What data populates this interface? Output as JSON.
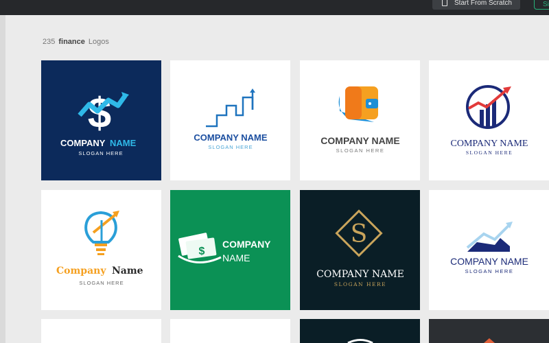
{
  "topbar": {
    "start_from_scratch": "Start From Scratch",
    "second_button": "Si"
  },
  "heading": {
    "count": "235",
    "term": "finance",
    "suffix": "Logos"
  },
  "logos": [
    {
      "name": "COMPANY",
      "name2": "NAME",
      "slogan": "SLOGAN HERE",
      "bg": "#0c2a5b"
    },
    {
      "name": "COMPANY NAME",
      "slogan": "SLOGAN HERE",
      "bg": "#ffffff"
    },
    {
      "name": "COMPANY NAME",
      "slogan": "SLOGAN HERE",
      "bg": "#ffffff"
    },
    {
      "name": "COMPANY NAME",
      "slogan": "SLOGAN HERE",
      "bg": "#ffffff"
    },
    {
      "name": "Company",
      "name2": "Name",
      "slogan": "SLOGAN HERE",
      "bg": "#ffffff"
    },
    {
      "name": "COMPANY",
      "name2": "NAME",
      "bg": "#0b9155"
    },
    {
      "name": "COMPANY NAME",
      "slogan": "SLOGAN HERE",
      "bg": "#0a1e26"
    },
    {
      "name": "COMPANY NAME",
      "slogan": "SLOGAN HERE",
      "bg": "#ffffff"
    }
  ]
}
